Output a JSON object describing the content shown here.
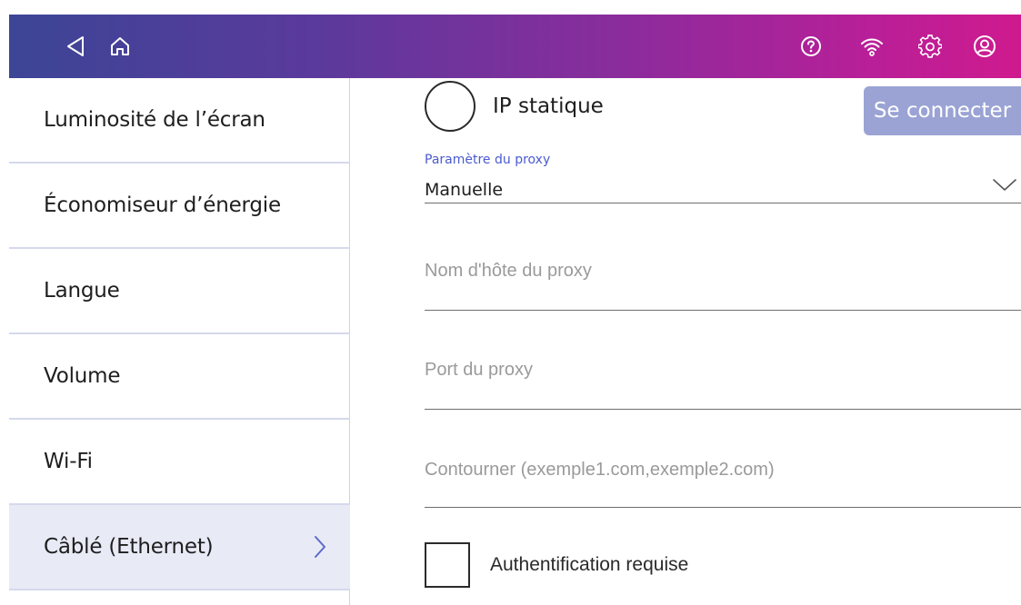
{
  "topbar": {
    "left_icons": [
      "back-icon",
      "home-icon"
    ],
    "right_icons": [
      "help-icon",
      "wifi-icon",
      "settings-icon",
      "account-icon"
    ]
  },
  "sidebar": {
    "items": [
      {
        "label": "Luminosité de l’écran"
      },
      {
        "label": "Économiseur d’énergie"
      },
      {
        "label": "Langue"
      },
      {
        "label": "Volume"
      },
      {
        "label": "Wi-Fi"
      },
      {
        "label": "Câblé (Ethernet)",
        "active": true
      }
    ]
  },
  "main": {
    "static_ip_label": "IP statique",
    "connect_button": "Se connecter",
    "proxy_setting": {
      "caption": "Paramètre du proxy",
      "value": "Manuelle"
    },
    "proxy_host_placeholder": "Nom d'hôte du proxy",
    "proxy_port_placeholder": "Port du proxy",
    "bypass_placeholder": "Contourner (exemple1.com,exemple2.com)",
    "auth_label": "Authentification requise"
  },
  "colors": {
    "accent": "#4a5bd0",
    "button_disabled": "#9aa3d4",
    "active_row": "#e8eaf6"
  }
}
